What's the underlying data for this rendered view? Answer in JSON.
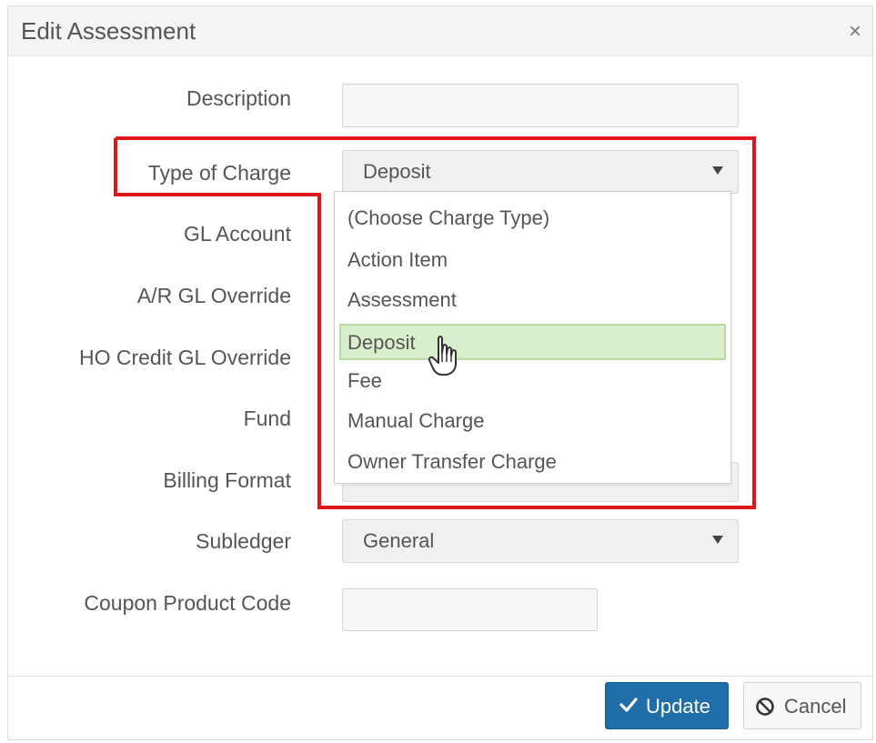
{
  "dialog": {
    "title": "Edit Assessment",
    "close_label": "×"
  },
  "fields": {
    "description": {
      "label": "Description",
      "value": ""
    },
    "type_of_charge": {
      "label": "Type of Charge",
      "value": "Deposit"
    },
    "gl_account": {
      "label": "GL Account"
    },
    "ar_gl_override": {
      "label": "A/R GL Override"
    },
    "ho_credit_gl_override": {
      "label": "HO Credit GL Override"
    },
    "fund": {
      "label": "Fund"
    },
    "billing_format": {
      "label": "Billing Format"
    },
    "subledger": {
      "label": "Subledger",
      "value": "General"
    },
    "coupon_product_code": {
      "label": "Coupon Product Code",
      "value": ""
    }
  },
  "dropdown": {
    "selected": "Deposit",
    "options": [
      "(Choose Charge Type)",
      "Action Item",
      "Assessment",
      "Deposit",
      "Fee",
      "Manual Charge",
      "Owner Transfer Charge"
    ]
  },
  "footer": {
    "update_label": "Update",
    "cancel_label": "Cancel"
  },
  "colors": {
    "highlight_outline": "#e0161b",
    "selected_option": "#d9efcc",
    "update_button": "#1f6ea8"
  },
  "icons": {
    "close": "close-icon",
    "check": "check-icon",
    "cancel": "ban-icon",
    "cursor": "hand-pointer-icon",
    "dropdown": "caret-down-icon"
  }
}
